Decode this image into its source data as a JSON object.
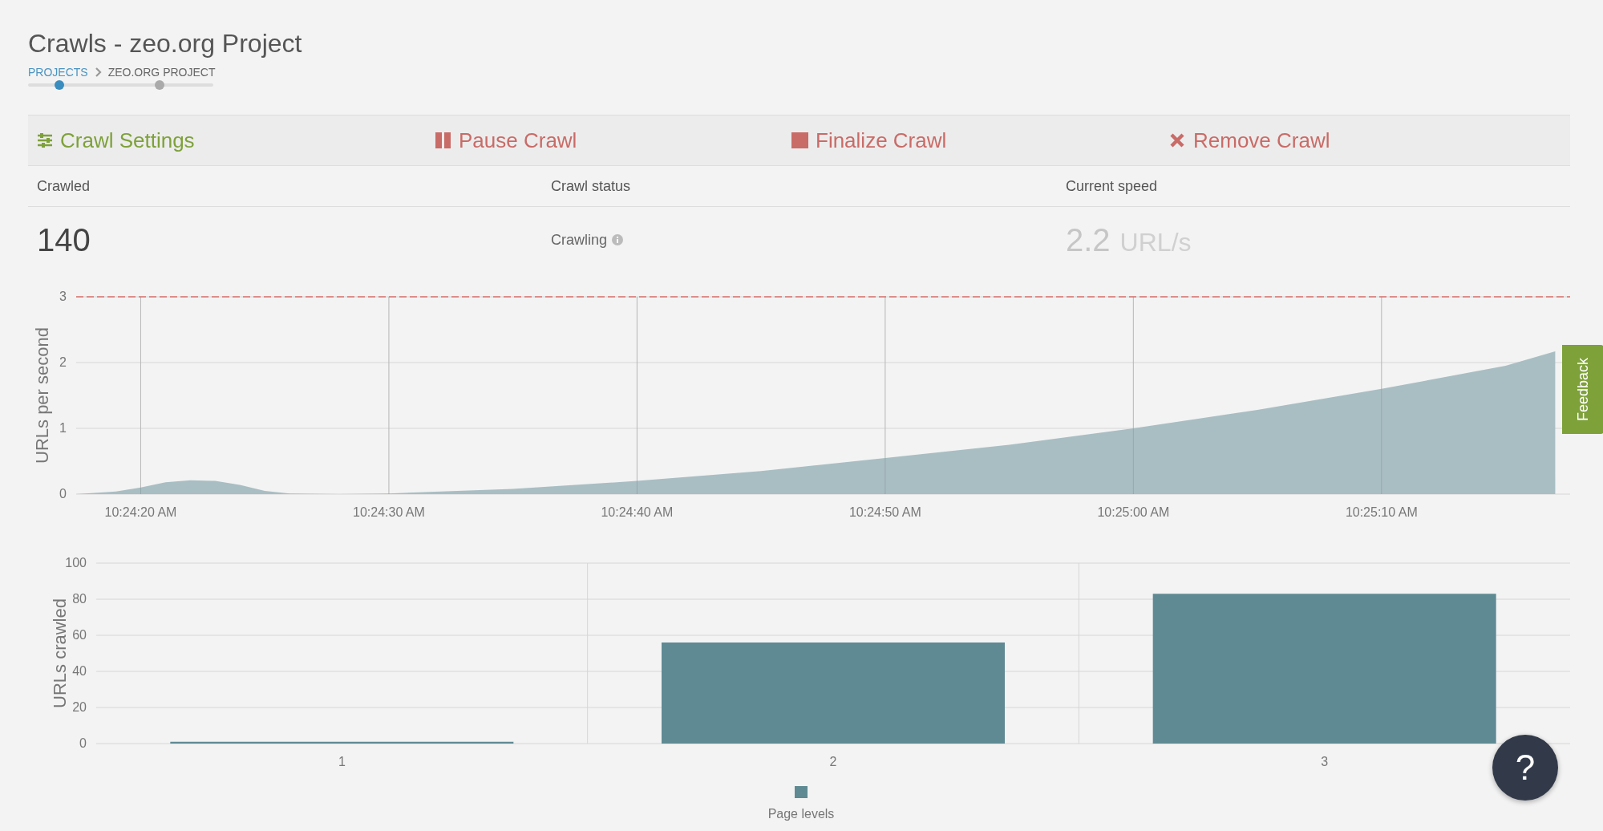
{
  "page": {
    "title": "Crawls - zeo.org Project"
  },
  "breadcrumb": [
    {
      "label": "PROJECTS",
      "kind": "link"
    },
    {
      "label": "ZEO.ORG PROJECT",
      "kind": "current"
    }
  ],
  "steps": [
    {
      "selected": true
    },
    {
      "selected": false
    }
  ],
  "actions": [
    {
      "label": "Crawl Settings",
      "kind": "settings"
    },
    {
      "label": "Pause Crawl",
      "kind": "pause"
    },
    {
      "label": "Finalize Crawl",
      "kind": "finalize"
    },
    {
      "label": "Remove Crawl",
      "kind": "remove"
    }
  ],
  "stats": [
    {
      "label": "Crawled",
      "value": "140",
      "kind": "number"
    },
    {
      "label": "Crawl status",
      "value": "Crawling",
      "kind": "status"
    },
    {
      "label": "Current speed",
      "value": "2.2",
      "unit": "URL/s",
      "kind": "speed"
    }
  ],
  "speed_chart": {
    "chart_data": {
      "type": "area",
      "ylabel": "URLs per second",
      "x": [
        37457.4,
        37459,
        37460,
        37461,
        37462,
        37463,
        37464,
        37465,
        37466,
        37468,
        37470,
        37475,
        37480,
        37485,
        37490,
        37495,
        37500,
        37505,
        37510,
        37515,
        37517
      ],
      "series": [
        {
          "color": "#a9bec3",
          "values": [
            0,
            0.04,
            0.1,
            0.18,
            0.21,
            0.2,
            0.14,
            0.05,
            0.01,
            0,
            0.01,
            0.08,
            0.2,
            0.35,
            0.55,
            0.75,
            1.0,
            1.28,
            1.6,
            1.95,
            2.17
          ]
        }
      ],
      "xlim": [
        37457.4,
        37517.6
      ],
      "ylim": [
        0,
        3
      ],
      "grid": true,
      "xticks": [
        {
          "value": 37460,
          "label": "10:24:20 AM"
        },
        {
          "value": 37470,
          "label": "10:24:30 AM"
        },
        {
          "value": 37480,
          "label": "10:24:40 AM"
        },
        {
          "value": 37490,
          "label": "10:24:50 AM"
        },
        {
          "value": 37500,
          "label": "10:25:00 AM"
        },
        {
          "value": 37510,
          "label": "10:25:10 AM"
        }
      ],
      "yticks": [
        0,
        1,
        2,
        3
      ]
    }
  },
  "levels_chart": {
    "chart_data": {
      "type": "bar",
      "ylabel": "URLs crawled",
      "categories": [
        "1",
        "2",
        "3"
      ],
      "series": [
        {
          "name": "Page levels",
          "color": "#5f8a94",
          "values": [
            1,
            56,
            83
          ]
        }
      ],
      "ylim": [
        0,
        100
      ],
      "yticks": [
        0,
        20,
        40,
        60,
        80,
        100
      ],
      "grid": true
    }
  },
  "feedback_tab": {
    "label": "Feedback"
  },
  "help_button": {
    "label": "?"
  }
}
